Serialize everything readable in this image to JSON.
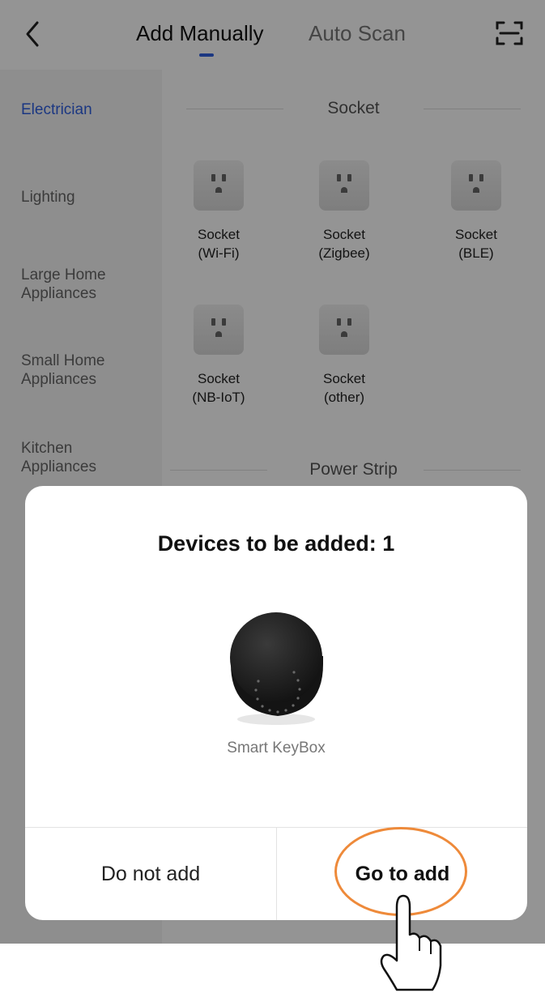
{
  "header": {
    "tabs": [
      {
        "label": "Add Manually",
        "active": true
      },
      {
        "label": "Auto Scan",
        "active": false
      }
    ],
    "back_icon": "chevron-left-icon",
    "scan_icon": "scan-icon"
  },
  "sidebar": {
    "categories": [
      {
        "label": "Electrician",
        "active": true
      },
      {
        "label": "Lighting"
      },
      {
        "label": "Large Home Appliances"
      },
      {
        "label": "Small Home Appliances"
      },
      {
        "label": "Kitchen Appliances"
      }
    ]
  },
  "main": {
    "sections": [
      {
        "title": "Socket",
        "devices": [
          {
            "label": "Socket (Wi-Fi)",
            "icon": "socket-icon"
          },
          {
            "label": "Socket (Zigbee)",
            "icon": "socket-icon"
          },
          {
            "label": "Socket (BLE)",
            "icon": "socket-icon"
          },
          {
            "label": "Socket (NB-IoT)",
            "icon": "socket-icon"
          },
          {
            "label": "Socket (other)",
            "icon": "socket-icon"
          }
        ]
      },
      {
        "title": "Power Strip"
      }
    ]
  },
  "dialog": {
    "title": "Devices to be added: 1",
    "device_name": "Smart KeyBox",
    "device_image": "smart-keybox-image",
    "cancel_label": "Do not add",
    "confirm_label": "Go to add"
  },
  "colors": {
    "accent": "#2f5fe0",
    "highlight": "#ee8a3a"
  }
}
